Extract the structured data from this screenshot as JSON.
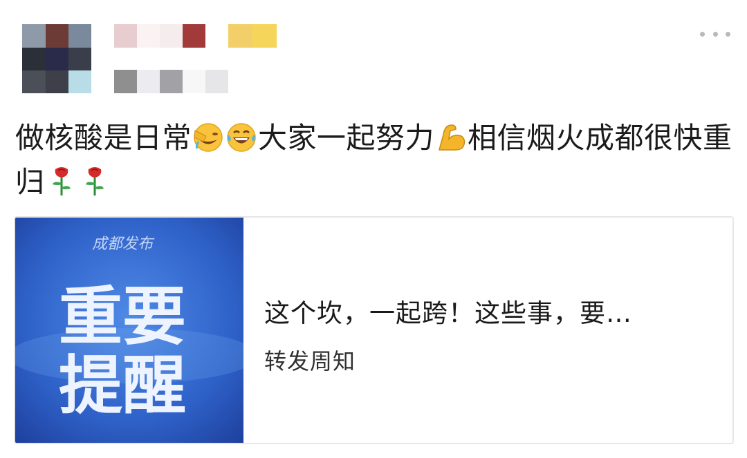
{
  "post": {
    "text_part1": "做核酸是日常",
    "text_part2": "大家一起努力",
    "text_part3": "相信烟火成都很快重归"
  },
  "emojis": {
    "facepalm": "facepalm-emoji",
    "laughing": "laughing-tears-emoji",
    "muscle": "flexed-biceps-emoji",
    "rose": "rose-emoji"
  },
  "shared_card": {
    "thumbnail_logo_text": "成都发布",
    "thumbnail_line1": "重要",
    "thumbnail_line2": "提醒",
    "title": "这个坎，一起跨！这些事，要…",
    "subtitle": "转发周知"
  },
  "colors": {
    "thumbnail_blue": "#2f62c9",
    "card_border": "#e6e6e6"
  }
}
